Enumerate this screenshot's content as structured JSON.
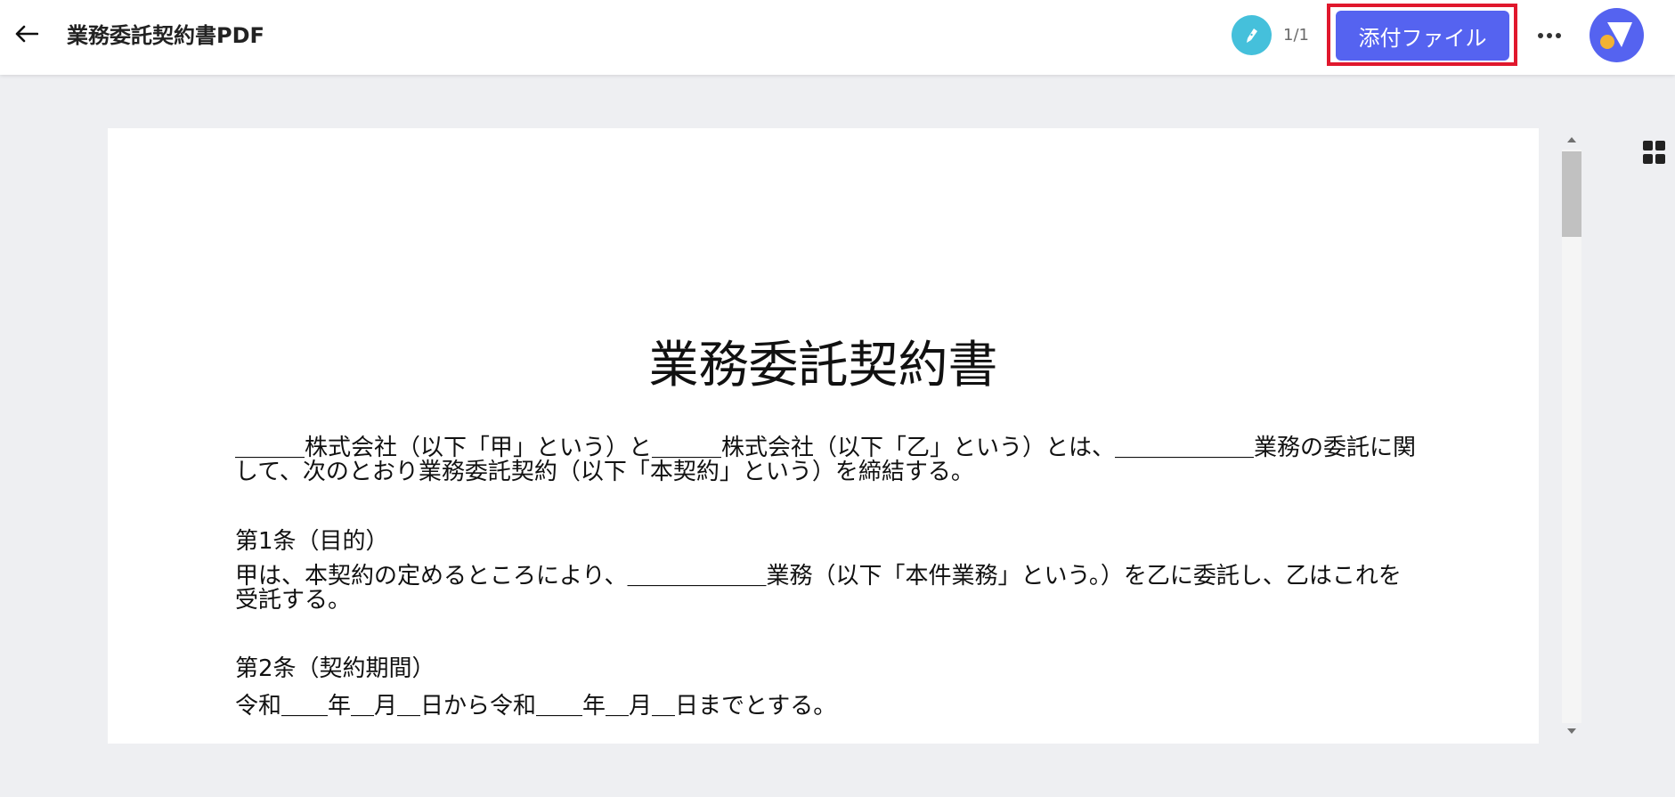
{
  "header": {
    "back_icon": "arrow-left-icon",
    "title": "業務委託契約書PDF",
    "signer_icon": "pen-icon",
    "page_counter": "1/1",
    "attach_label": "添付ファイル",
    "more_icon": "ellipsis-icon",
    "avatar_icon": "user-avatar-icon"
  },
  "colors": {
    "accent": "#5563f0",
    "highlight": "#e0182d",
    "signer": "#45c0db",
    "avatar_dot": "#f2b233"
  },
  "document": {
    "heading": "業務委託契約書",
    "intro": "＿＿＿株式会社（以下「甲」という）と＿＿＿株式会社（以下「乙」という）とは、＿＿＿＿＿＿業務の委託に関して、次のとおり業務委託契約（以下「本契約」という）を締結する。",
    "articles": [
      {
        "heading": "第1条（目的）",
        "body": "甲は、本契約の定めるところにより、＿＿＿＿＿＿業務（以下「本件業務」という。）を乙に委託し、乙はこれを受託する。"
      },
      {
        "heading": "第2条（契約期間）",
        "body": "令和＿＿年＿月＿日から令和＿＿年＿月＿日までとする。"
      }
    ]
  },
  "sidebar": {
    "grid_icon": "grid-view-icon"
  }
}
